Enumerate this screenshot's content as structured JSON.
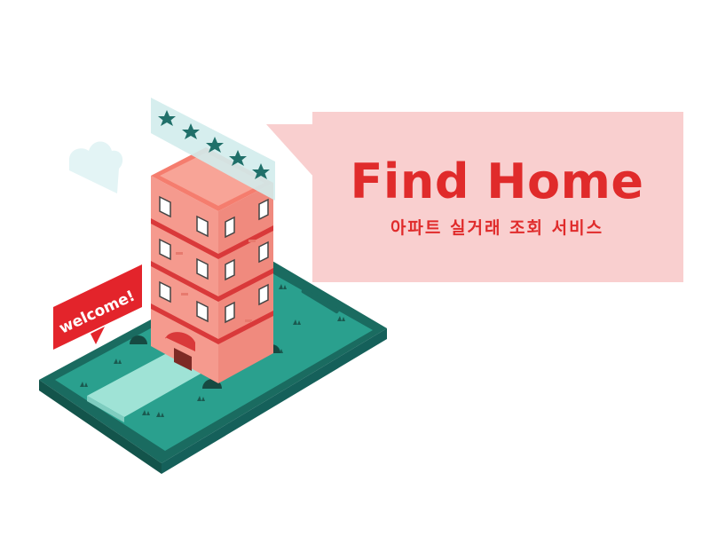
{
  "app": {
    "title": "Find Home",
    "subtitle": "아파트 실거래 조회 서비스"
  },
  "sign": {
    "text": "welcome!"
  },
  "rating": {
    "stars": 5,
    "max": 5,
    "icon": "star-icon"
  },
  "icons": [
    "cloud-icon",
    "star-icon",
    "awning-icon",
    "bush-icon",
    "grass-icon"
  ],
  "colors": {
    "brand_red": "#e02b2b",
    "speech_bubble": "#f9cfcf",
    "phone_teal": "#1e7a6d",
    "screen_teal": "#2aa08e",
    "path_mint": "#9fe3d6",
    "building_pink": "#f59a8e",
    "building_roof": "#f57d6e",
    "star_teal": "#20706a",
    "cloud": "#e3f4f5",
    "sign_red": "#e3242b"
  }
}
